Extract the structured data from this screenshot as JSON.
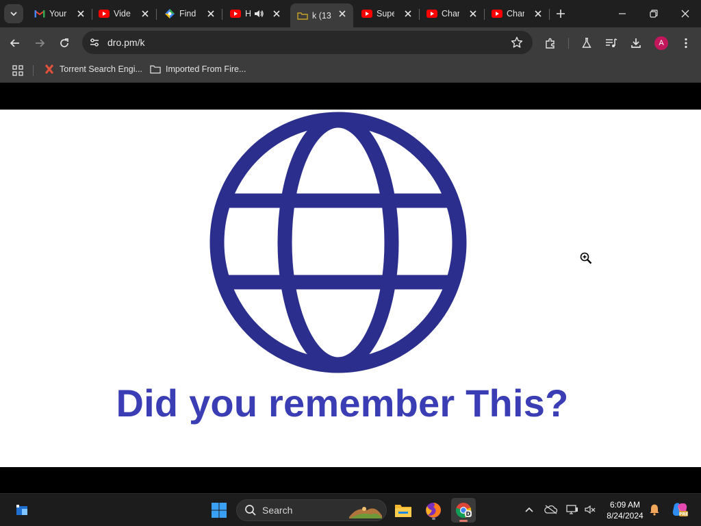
{
  "tabs": [
    {
      "title": "Your",
      "icon": "gmail-icon"
    },
    {
      "title": "Vide",
      "icon": "youtube-icon"
    },
    {
      "title": "Find",
      "icon": "google-lens-icon"
    },
    {
      "title": "H",
      "icon": "youtube-icon"
    },
    {
      "title": "k (13",
      "icon": "file-icon",
      "active": true
    },
    {
      "title": "Supe",
      "icon": "youtube-icon"
    },
    {
      "title": "Char",
      "icon": "youtube-icon"
    },
    {
      "title": "Char",
      "icon": "youtube-icon"
    }
  ],
  "toolbar": {
    "url": "dro.pm/k"
  },
  "bookmarks": [
    {
      "label": "Torrent Search Engi...",
      "icon": "torrent-x-icon"
    },
    {
      "label": "Imported From Fire...",
      "icon": "folder-icon"
    }
  ],
  "page": {
    "caption": "Did you remember This?",
    "globe_color": "#2b2e8c",
    "caption_color": "#3a3db4"
  },
  "taskbar": {
    "search_label": "Search",
    "time": "6:09 AM",
    "date": "8/24/2024"
  },
  "profile": {
    "avatar_letter": "A"
  }
}
